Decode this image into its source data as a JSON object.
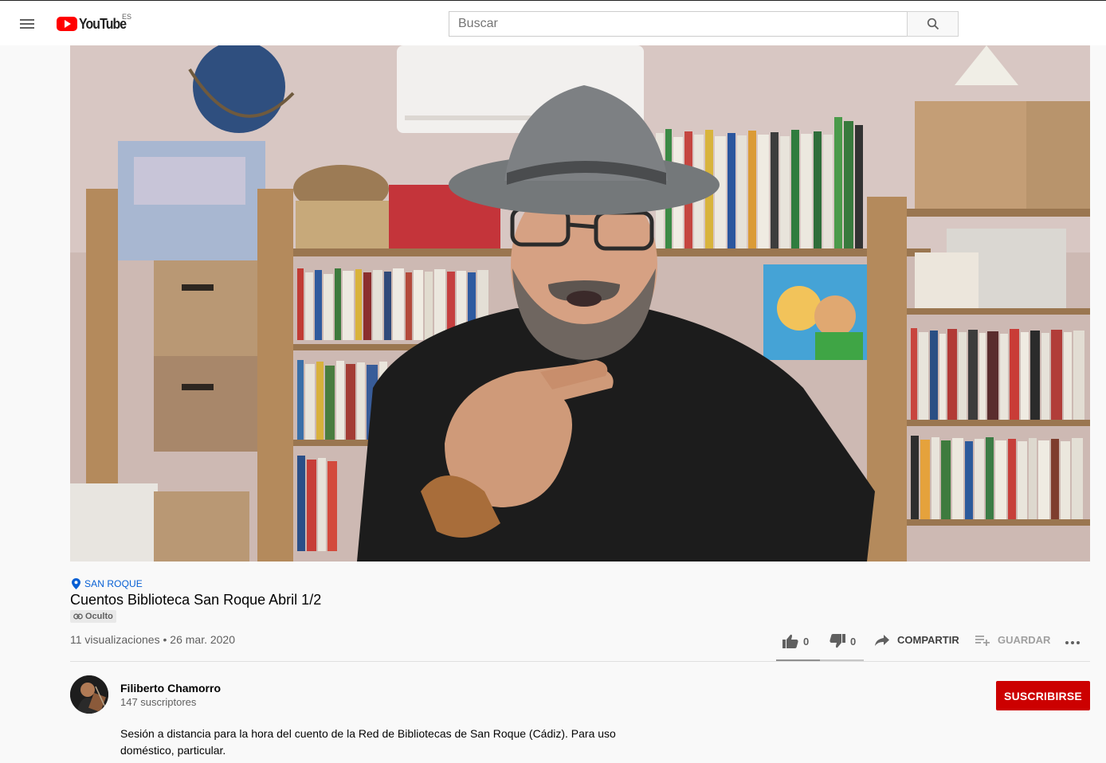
{
  "header": {
    "logo_text": "YouTube",
    "region": "ES",
    "search_placeholder": "Buscar",
    "icons": [
      "menu-icon",
      "youtube-logo",
      "search-icon"
    ]
  },
  "video": {
    "location": "SAN ROQUE",
    "title": "Cuentos Biblioteca San Roque Abril 1/2",
    "privacy_label": "Oculto",
    "views": "11 visualizaciones",
    "separator": "•",
    "date": "26 mar. 2020"
  },
  "actions": {
    "likes": "0",
    "dislikes": "0",
    "share_label": "COMPARTIR",
    "save_label": "GUARDAR",
    "like_ratio": 0.5
  },
  "channel": {
    "name": "Filiberto Chamorro",
    "subscribers": "147 suscriptores",
    "subscribe_label": "SUSCRIBIRSE"
  },
  "description": {
    "line1": "Sesión a distancia para la hora del cuento de la Red de Bibliotecas de San Roque (Cádiz). Para uso",
    "line2": "doméstico, particular."
  },
  "colors": {
    "accent_red": "#cc0000",
    "link_blue": "#065fd4",
    "text_secondary": "#606060"
  }
}
